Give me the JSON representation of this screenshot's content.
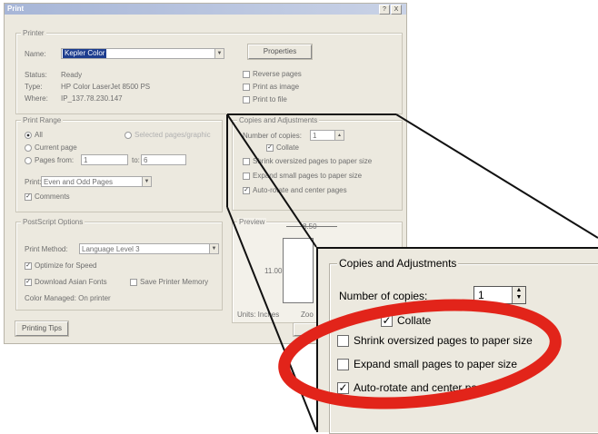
{
  "window": {
    "title": "Print",
    "help_btn": "?",
    "close_btn": "X"
  },
  "printer": {
    "legend": "Printer",
    "name_label": "Name:",
    "name_value": "Kepler Color",
    "properties_btn": "Properties",
    "status_label": "Status:",
    "status_value": "Ready",
    "type_label": "Type:",
    "type_value": "HP Color LaserJet 8500 PS",
    "where_label": "Where:",
    "where_value": "IP_137.78.230.147",
    "reverse_pages": "Reverse pages",
    "print_as_image": "Print as image",
    "print_to_file": "Print to file"
  },
  "print_range": {
    "legend": "Print Range",
    "all": "All",
    "selected_pages": "Selected pages/graphic",
    "current_page": "Current page",
    "pages_from": "Pages from:",
    "from_value": "1",
    "to_label": "to:",
    "to_value": "6",
    "print_label": "Print:",
    "print_value": "Even and Odd Pages",
    "comments": "Comments"
  },
  "copies": {
    "legend": "Copies and Adjustments",
    "number_label": "Number of copies:",
    "number_value": "1",
    "collate": "Collate",
    "shrink": "Shrink oversized pages to paper size",
    "expand": "Expand small pages to paper size",
    "autorotate": "Auto-rotate and center pages"
  },
  "postscript": {
    "legend": "PostScript Options",
    "method_label": "Print Method:",
    "method_value": "Language Level 3",
    "optimize": "Optimize for Speed",
    "download_fonts": "Download Asian Fonts",
    "save_memory": "Save Printer Memory",
    "color_managed": "Color Managed:  On printer"
  },
  "preview": {
    "legend": "Preview",
    "width_value": "8.50",
    "height_value": "11.00",
    "units": "Units: Inches",
    "zoom": "Zoo"
  },
  "printing_tips_btn": "Printing Tips",
  "zoom_panel": {
    "legend": "Copies and Adjustments",
    "number_label": "Number of copies:",
    "number_value": "1",
    "collate": "Collate",
    "shrink": "Shrink oversized pages to paper size",
    "expand": "Expand small pages to paper size",
    "autorotate": "Auto-rotate and center pages"
  },
  "colors": {
    "highlight_ellipse": "#e2241a",
    "title_gradient_start": "#a7b6d7",
    "selection": "#1d3d8f"
  }
}
